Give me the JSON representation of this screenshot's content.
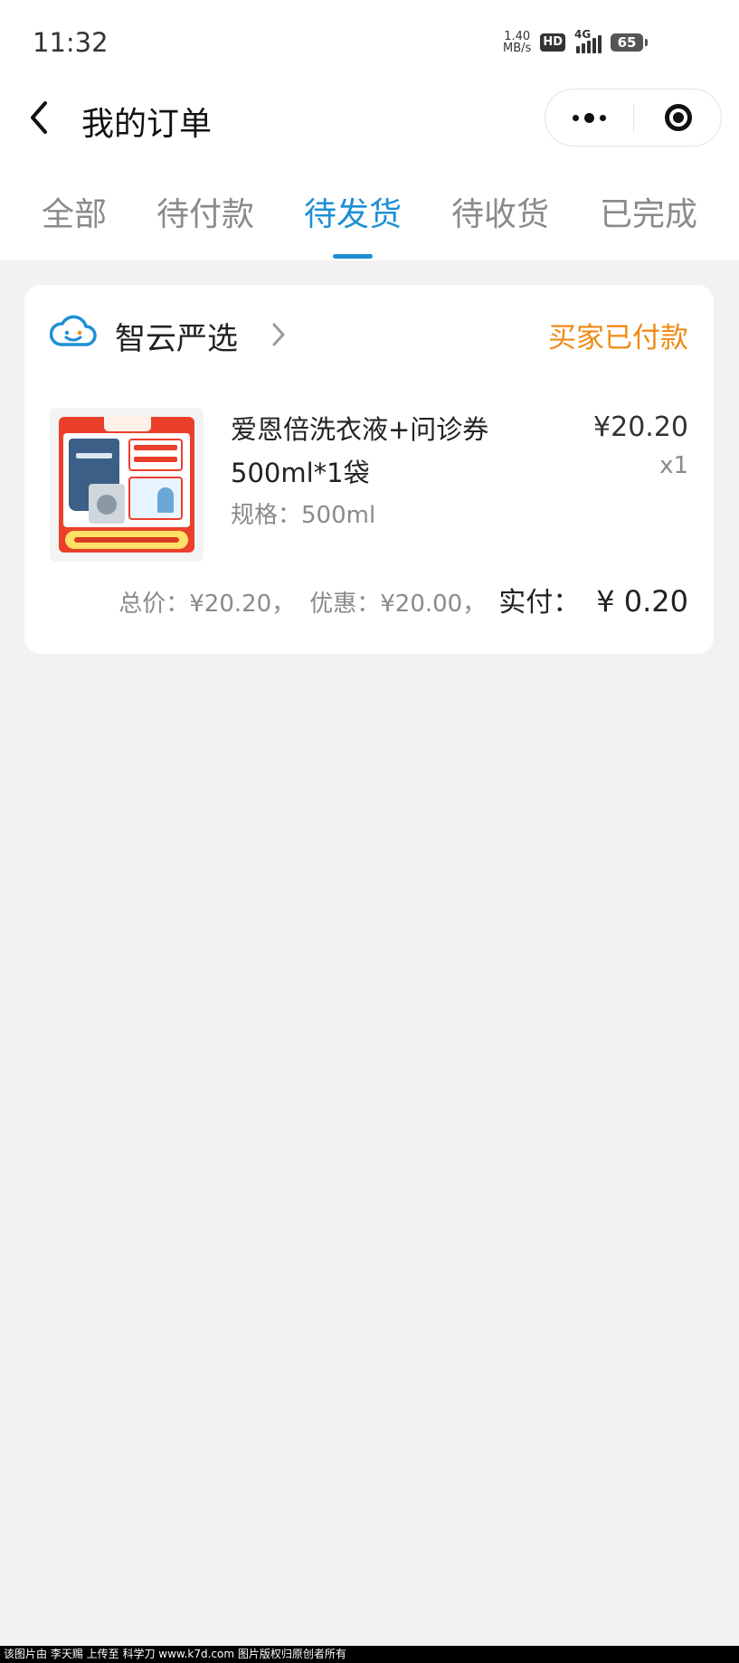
{
  "status_bar": {
    "time": "11:32",
    "net_speed_value": "1.40",
    "net_speed_unit": "MB/s",
    "hd_label": "HD",
    "network": "4G",
    "battery": "65"
  },
  "nav": {
    "title": "我的订单",
    "back_icon": "chevron-left-icon",
    "more_icon": "more-dots-icon",
    "close_icon": "target-circle-icon"
  },
  "tabs": [
    {
      "label": "全部",
      "active": false
    },
    {
      "label": "待付款",
      "active": false
    },
    {
      "label": "待发货",
      "active": true
    },
    {
      "label": "待收货",
      "active": false
    },
    {
      "label": "已完成",
      "active": false
    }
  ],
  "order": {
    "shop_name": "智云严选",
    "shop_icon": "cloud-smile-icon",
    "status": "买家已付款",
    "product": {
      "name": "爱恩倍洗衣液+问诊券500ml*1袋",
      "spec": "规格：500ml",
      "price": "¥20.20",
      "quantity": "x1"
    },
    "summary": {
      "total_label": "总价：",
      "total_value": "¥20.20，",
      "discount_label": "优惠：",
      "discount_value": "¥20.00，",
      "paid_label": "实付：",
      "paid_value": "¥ 0.20"
    }
  },
  "watermark": "该图片由 李天赐 上传至 科学刀 www.k7d.com 图片版权归原创者所有",
  "colors": {
    "accent_blue": "#1e8fd6",
    "status_orange": "#f08a14",
    "page_background": "#f2f2f2"
  }
}
